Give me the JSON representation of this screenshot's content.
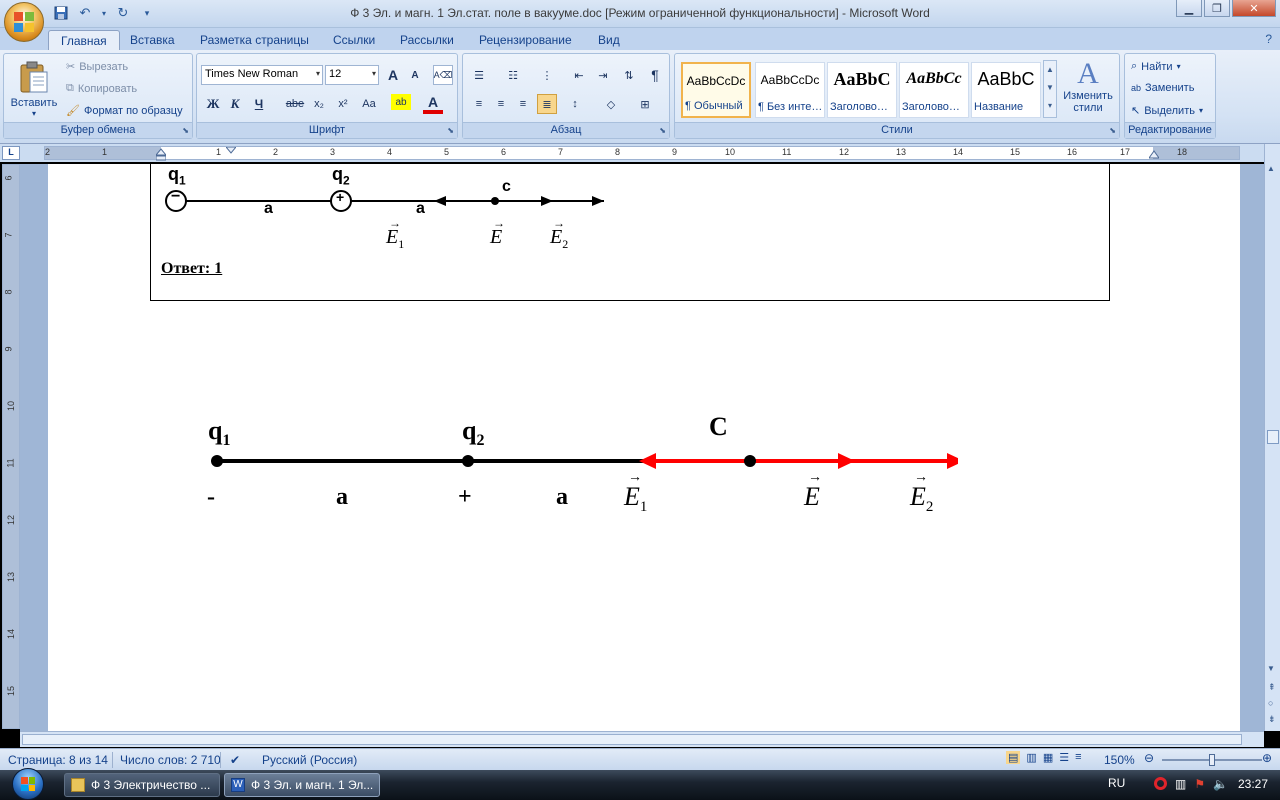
{
  "window": {
    "title": "Ф 3 Эл. и магн. 1 Эл.стат. поле в вакууме.doc [Режим ограниченной функциональности]  -  Microsoft Word"
  },
  "ribbon_tabs": [
    "Главная",
    "Вставка",
    "Разметка страницы",
    "Ссылки",
    "Рассылки",
    "Рецензирование",
    "Вид"
  ],
  "clipboard": {
    "paste": "Вставить",
    "cut": "Вырезать",
    "copy": "Копировать",
    "format_painter": "Формат по образцу",
    "label": "Буфер обмена"
  },
  "font": {
    "name": "Times New Roman",
    "size": "12",
    "label": "Шрифт",
    "bold": "Ж",
    "italic": "К",
    "underline": "Ч",
    "strike": "abe",
    "subscript": "x₂",
    "superscript": "x²",
    "case": "Aa",
    "grow": "A",
    "shrink": "A",
    "highlight": "ab",
    "color": "A"
  },
  "paragraph": {
    "label": "Абзац",
    "pilcrow": "¶"
  },
  "styles": {
    "label": "Стили",
    "items": [
      {
        "sample": "AaBbCcDc",
        "name": "¶ Обычный"
      },
      {
        "sample": "AaBbCcDc",
        "name": "¶ Без инте…"
      },
      {
        "sample": "AaBbC",
        "name": "Заголово…"
      },
      {
        "sample": "AaBbCc",
        "name": "Заголово…"
      },
      {
        "sample": "AaBbC",
        "name": "Название"
      }
    ],
    "change": "Изменить стили"
  },
  "editing": {
    "label": "Редактирование",
    "find": "Найти",
    "replace": "Заменить",
    "select": "Выделить"
  },
  "ruler": {
    "h_numbers": [
      "2",
      "1",
      "1",
      "2",
      "3",
      "4",
      "5",
      "6",
      "7",
      "8",
      "9",
      "10",
      "11",
      "12",
      "13",
      "14",
      "15",
      "16",
      "17",
      "18"
    ],
    "v_numbers": [
      "6",
      "7",
      "8",
      "9",
      "10",
      "11",
      "12",
      "13",
      "14",
      "15"
    ]
  },
  "document": {
    "scan": {
      "q1": "q",
      "q1_sub": "1",
      "q2": "q",
      "q2_sub": "2",
      "a1": "a",
      "a2": "a",
      "c": "c",
      "q1_sign": "−",
      "q2_sign": "+",
      "e1": "E",
      "e1_sub": "1",
      "e": "E",
      "e2": "E",
      "e2_sub": "2"
    },
    "answer": "Ответ: 1",
    "figure": {
      "q1": "q",
      "q1_sub": "1",
      "q2": "q",
      "q2_sub": "2",
      "c": "C",
      "minus": "-",
      "a1": "a",
      "plus": "+",
      "a2": "a",
      "e1": "E",
      "e1_sub": "1",
      "e": "E",
      "e2": "E",
      "e2_sub": "2",
      "colors": {
        "line": "#000000",
        "vectors": "#ff0000"
      }
    }
  },
  "status": {
    "page": "Страница: 8 из 14",
    "words": "Число слов: 2 710",
    "language": "Русский (Россия)",
    "zoom": "150%"
  },
  "taskbar": {
    "items": [
      "Ф 3 Электричество ...",
      "Ф 3 Эл. и магн. 1 Эл..."
    ],
    "lang": "RU",
    "time": "23:27"
  }
}
